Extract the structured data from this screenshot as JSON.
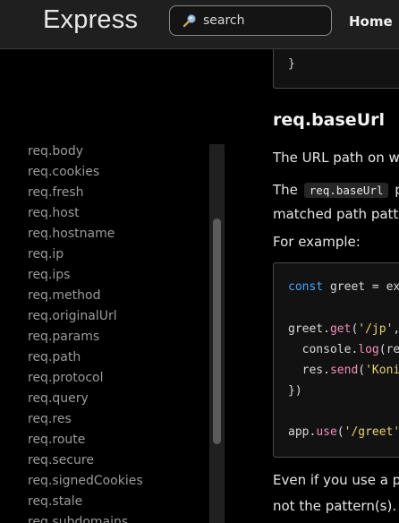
{
  "header": {
    "logo": "Express",
    "search_placeholder": "search",
    "nav_home": "Home"
  },
  "sidebar": {
    "items": [
      "req.body",
      "req.cookies",
      "req.fresh",
      "req.host",
      "req.hostname",
      "req.ip",
      "req.ips",
      "req.method",
      "req.originalUrl",
      "req.params",
      "req.path",
      "req.protocol",
      "req.query",
      "req.res",
      "req.route",
      "req.secure",
      "req.signedCookies",
      "req.stale",
      "req.subdomains"
    ]
  },
  "content": {
    "top_code_brace": "}",
    "heading": "req.baseUrl",
    "para1": "The URL path on wh",
    "para2_before": "The",
    "para2_code": "req.baseUrl",
    "para2_after": "p",
    "para3": "matched path patte",
    "para4": "For example:",
    "code": {
      "l1_kw": "const",
      "l1_rest": " greet = ex",
      "l2_obj": "greet.",
      "l2_fn": "get",
      "l2_open": "(",
      "l2_str": "'/jp'",
      "l2_rest": ",",
      "l3_pre": "  console.",
      "l3_fn": "log",
      "l3_rest": "(re",
      "l4_pre": "  res.",
      "l4_fn": "send",
      "l4_open": "(",
      "l4_str": "'Koni",
      "l5": "})",
      "l6_obj": "app.",
      "l6_fn": "use",
      "l6_open": "(",
      "l6_str": "'/greet'"
    },
    "para5": "Even if you use a pa",
    "para6": "not the pattern(s). I"
  },
  "colors": {
    "keyword": "#4aa3ff",
    "function": "#f08fb8",
    "string": "#e6d06e"
  }
}
